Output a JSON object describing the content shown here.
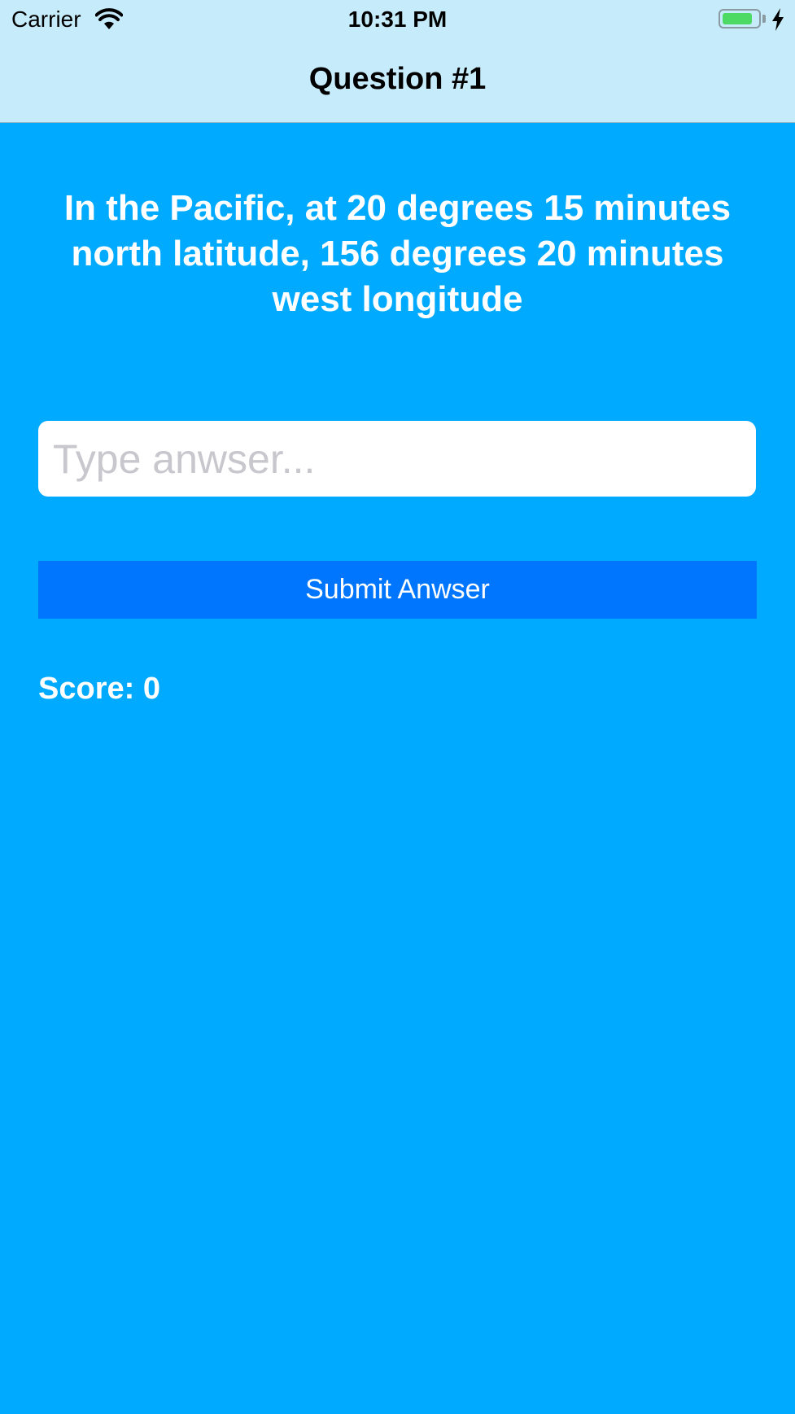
{
  "status_bar": {
    "carrier": "Carrier",
    "time": "10:31 PM",
    "battery_level": 0.85,
    "charging": true
  },
  "nav": {
    "title": "Question #1"
  },
  "question": {
    "text": "In the Pacific, at 20 degrees 15 minutes north latitude, 156 degrees 20 minutes west longitude"
  },
  "answer": {
    "value": "",
    "placeholder": "Type anwser..."
  },
  "submit": {
    "label": "Submit Anwser"
  },
  "score": {
    "text": "Score: 0"
  },
  "colors": {
    "background": "#00abff",
    "bar": "#c6ebfa",
    "button": "#0076ff",
    "battery": "#4cd964"
  }
}
